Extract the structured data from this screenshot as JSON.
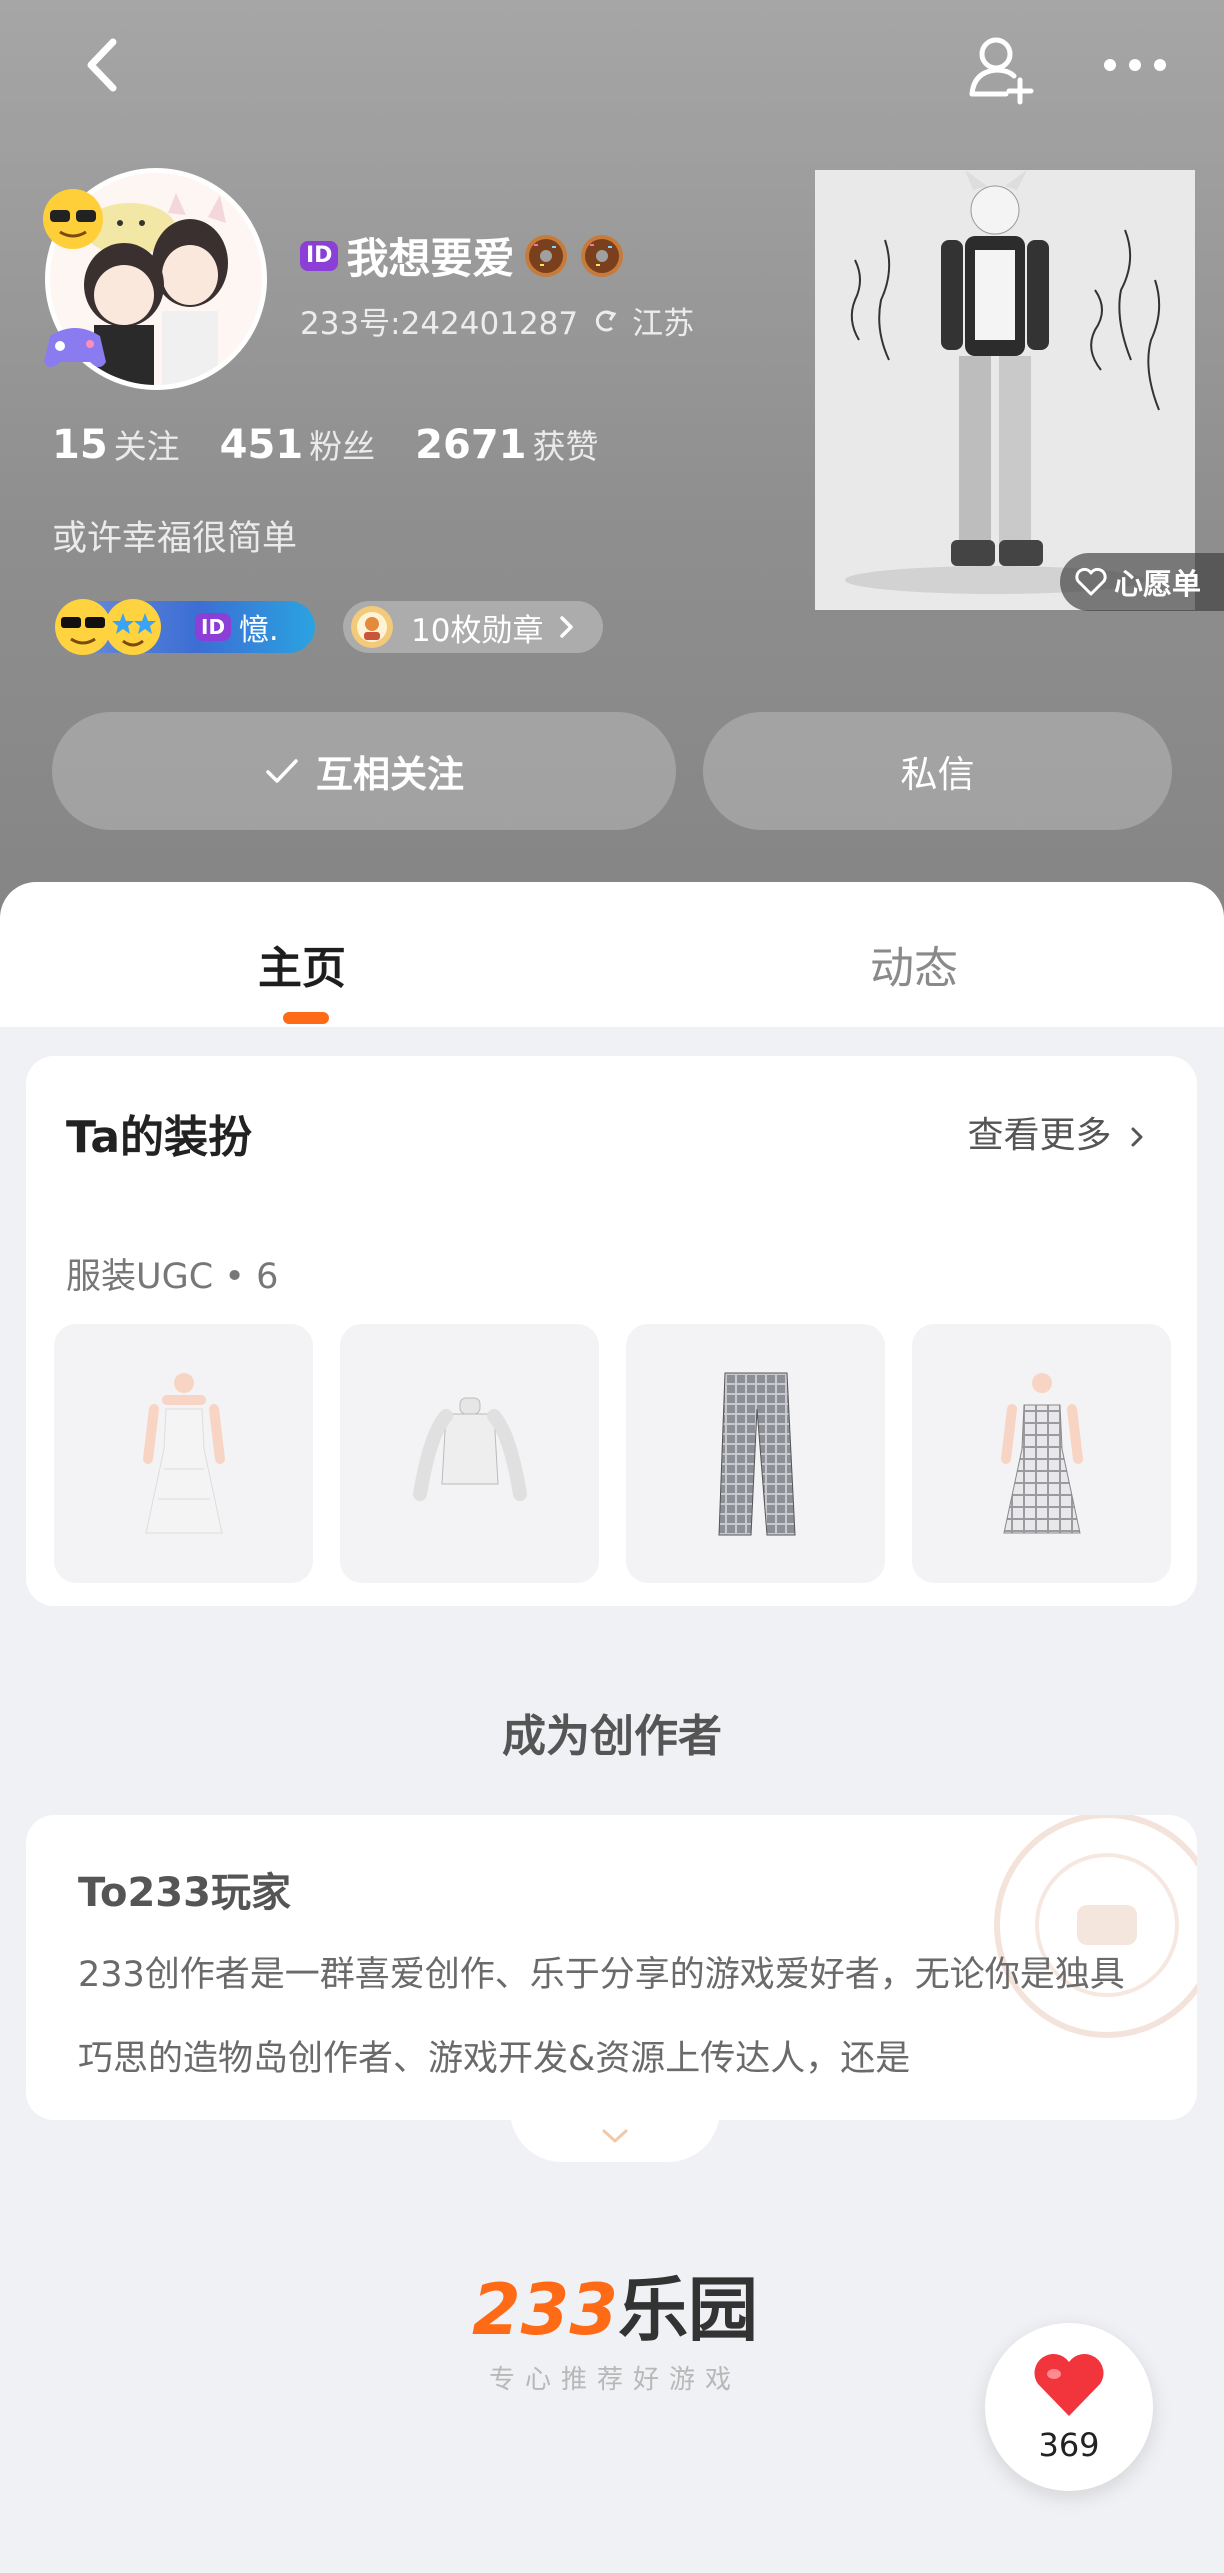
{
  "profile": {
    "id_badge": "ID",
    "name": "我想要爱",
    "account_no": "233号:242401287",
    "location": "江苏",
    "bio": "或许幸福很简单"
  },
  "stats": [
    {
      "value": "15",
      "label": "关注"
    },
    {
      "value": "451",
      "label": "粉丝"
    },
    {
      "value": "2671",
      "label": "获赞"
    }
  ],
  "badges": {
    "id_badge": "ID",
    "title_text": "憶.",
    "medals_text": "10枚勋章"
  },
  "actions": {
    "follow_label": "互相关注",
    "message_label": "私信",
    "wishlist_label": "心愿单"
  },
  "tabs": [
    {
      "label": "主页",
      "active": true
    },
    {
      "label": "动态",
      "active": false
    }
  ],
  "outfit_card": {
    "title": "Ta的装扮",
    "see_more": "查看更多",
    "ugc_label": "服装UGC • 6",
    "items": [
      {
        "icon": "dress-white-icon"
      },
      {
        "icon": "top-white-icon"
      },
      {
        "icon": "pants-plaid-icon"
      },
      {
        "icon": "dress-plaid-icon"
      }
    ]
  },
  "creator": {
    "heading": "成为创作者",
    "title": "To233玩家",
    "text": "233创作者是一群喜爱创作、乐于分享的游戏爱好者，无论你是独具巧思的造物岛创作者、游戏开发&资源上传达人，还是"
  },
  "footer": {
    "logo_num": "233",
    "logo_cn": "乐园",
    "slogan": "专心推荐好游戏"
  },
  "like": {
    "count": "369"
  },
  "colors": {
    "accent": "#ff6a17",
    "like_red": "#f2353d"
  }
}
